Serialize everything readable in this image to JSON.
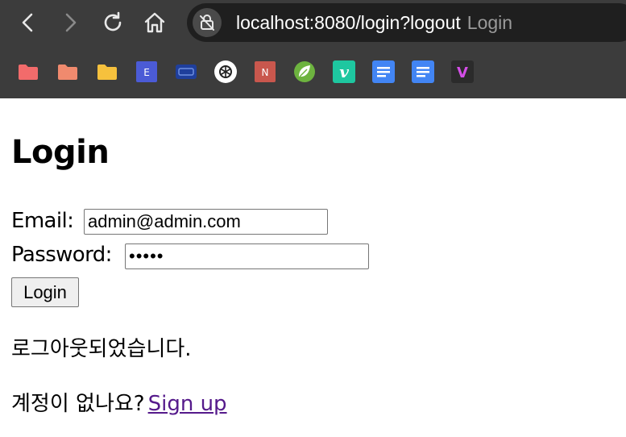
{
  "browser": {
    "url": "localhost:8080/login?logout",
    "tab_title": "Login",
    "bookmarks": [
      {
        "icon": "folder-icon",
        "color": "#f26b6b"
      },
      {
        "icon": "folder-icon",
        "color": "#f08a6e"
      },
      {
        "icon": "folder-icon",
        "color": "#f6c13d"
      },
      {
        "icon": "e-app-icon",
        "color": "#4b5bd6",
        "text": "E"
      },
      {
        "icon": "card-icon",
        "color": "#1f3f9c"
      },
      {
        "icon": "openai-icon",
        "color": "#ffffff"
      },
      {
        "icon": "n-app-icon",
        "color": "#c9574d",
        "text": "N"
      },
      {
        "icon": "spring-leaf-icon",
        "color": "#6db33f"
      },
      {
        "icon": "vimeo-icon",
        "color": "#1ab7ea",
        "text": "v"
      },
      {
        "icon": "docs-icon",
        "color": "#4285f4"
      },
      {
        "icon": "docs-icon",
        "color": "#4285f4"
      },
      {
        "icon": "v-app-icon",
        "color": "#2b2b2b",
        "text": "V"
      }
    ]
  },
  "page": {
    "title": "Login",
    "email_label": "Email:",
    "email_value": "admin@admin.com",
    "password_label": "Password:",
    "password_value": "•••••",
    "login_button": "Login",
    "logout_message": "로그아웃되었습니다.",
    "no_account_text": "계정이 없나요?",
    "signup_link": "Sign up"
  }
}
